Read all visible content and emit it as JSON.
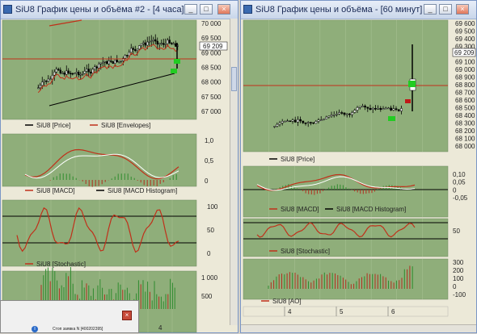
{
  "left_window": {
    "title": "SiU8 График цены и объёма #2 - [4 часа]",
    "price_axis": [
      "70 000",
      "69 500",
      "69 000",
      "68 500",
      "68 000",
      "67 500",
      "67 000"
    ],
    "last_price": "69 209",
    "legend_price": "SiU8 [Price]",
    "legend_envelopes": "SiU8 [Envelopes]",
    "macd_axis": [
      "1,0",
      "0,5",
      "0"
    ],
    "legend_macd": "SiU8 [MACD]",
    "legend_macd_hist": "SiU8 [MACD Histogram]",
    "stoch_axis": [
      "100",
      "50",
      "0"
    ],
    "legend_stoch": "SiU8 [Stochastic]",
    "volume_axis": [
      "1 000",
      "500"
    ],
    "time_label": "4"
  },
  "right_window": {
    "title": "SiU8 График цены и объёма - [60 минут]",
    "price_axis": [
      "69 600",
      "69 500",
      "69 400",
      "69 300",
      "69 200",
      "69 100",
      "69 000",
      "68 900",
      "68 800",
      "68 700",
      "68 600",
      "68 500",
      "68 400",
      "68 300",
      "68 200",
      "68 100",
      "68 000"
    ],
    "last_price": "69 209",
    "legend_price": "SiU8 [Price]",
    "macd_axis": [
      "0,10",
      "0,05",
      "0",
      "-0,05"
    ],
    "legend_macd": "SiU8 [MACD]",
    "legend_macd_hist": "SiU8 [MACD Histogram]",
    "stoch_axis": [
      "50"
    ],
    "legend_stoch": "SiU8 [Stochastic]",
    "ao_axis": [
      "300",
      "200",
      "100",
      "0",
      "-100"
    ],
    "legend_ao": "SiU8 [AO]",
    "time_labels": [
      "4",
      "5",
      "6"
    ]
  },
  "dialog": {
    "close_glyph": "×",
    "info_glyph": "i",
    "text": "Стоп заявка N [400202395]"
  },
  "buttons": {
    "min": "_",
    "max": "□",
    "close": "×"
  },
  "colors": {
    "pane_bg": "#8fae7a",
    "grid": "#a9c294",
    "price": "#000000",
    "envelope": "#c0301a",
    "signal": "#ffffff",
    "hist_up": "#2e8b2e",
    "hist_down": "#b03020"
  }
}
